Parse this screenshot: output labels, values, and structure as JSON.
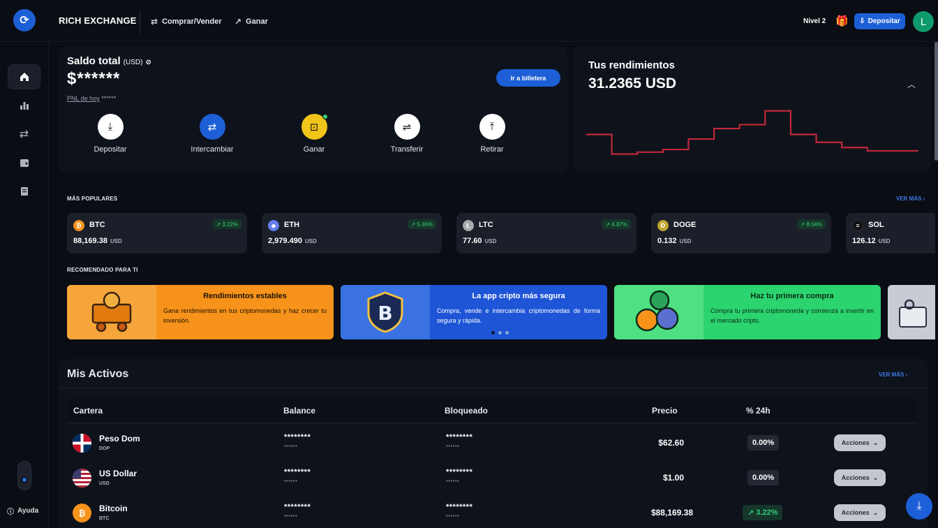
{
  "topbar": {
    "brand": "RICH EXCHANGE",
    "nav": [
      {
        "label": "Comprar/Vender",
        "icon": "swap-icon"
      },
      {
        "label": "Ganar",
        "icon": "trend-up-icon"
      }
    ],
    "level": "Nivel 2",
    "deposit_label": "Depositar",
    "avatar_initial": "L"
  },
  "sidebar": {
    "items": [
      "home-icon",
      "chart-bar-icon",
      "swap-icon",
      "wallet-icon",
      "receipt-icon"
    ],
    "help_label": "Ayuda"
  },
  "balance": {
    "label": "Saldo total",
    "currency": "(USD)",
    "value": "$******",
    "pnl_label": "PNL de hoy",
    "pnl_value": "******",
    "wallet_button": "Ir a billetera"
  },
  "actions": [
    {
      "label": "Depositar",
      "icon": "deposit-icon",
      "color": "#ffffff"
    },
    {
      "label": "Intercambiar",
      "icon": "swap-icon",
      "color": "#1d5fd6"
    },
    {
      "label": "Ganar",
      "icon": "earn-icon",
      "color": "#f0c419"
    },
    {
      "label": "Transferir",
      "icon": "transfer-icon",
      "color": "#ffffff"
    },
    {
      "label": "Retirar",
      "icon": "withdraw-icon",
      "color": "#ffffff"
    }
  ],
  "performance": {
    "title": "Tus rendimientos",
    "value": "31.2365 USD",
    "line_color": "#c0283a",
    "steps": [
      4,
      1,
      1.3,
      1.7,
      3.3,
      4.9,
      5.5,
      7.6,
      4,
      2.8,
      2,
      1.5,
      1.5
    ]
  },
  "popular": {
    "title": "MÁS POPULARES",
    "more": "VER MÁS",
    "coins": [
      {
        "symbol": "BTC",
        "price": "88,169.38",
        "unit": "USD",
        "change": "3.22%",
        "color": "#f7931a",
        "glyph": "₿"
      },
      {
        "symbol": "ETH",
        "price": "2,979.490",
        "unit": "USD",
        "change": "5.46%",
        "color": "#627eea",
        "glyph": "◆"
      },
      {
        "symbol": "LTC",
        "price": "77.60",
        "unit": "USD",
        "change": "4.87%",
        "color": "#a6a9aa",
        "glyph": "Ł"
      },
      {
        "symbol": "DOGE",
        "price": "0.132",
        "unit": "USD",
        "change": "8.04%",
        "color": "#c2a633",
        "glyph": "Ð"
      },
      {
        "symbol": "SOL",
        "price": "126.12",
        "unit": "USD",
        "change": "",
        "color": "#111111",
        "glyph": "≡"
      }
    ]
  },
  "recommended": {
    "title": "RECOMENDADO PARA TI",
    "banners": [
      {
        "title": "Rendimientos estables",
        "text": "Gana rendimientos en tus criptomonedas y haz crecer tu inversión.",
        "bg": "#f7931a",
        "art_bg": "#f5a53a",
        "text_color": "#1a1205",
        "icon": "mining-cart-icon"
      },
      {
        "title": "La app cripto más segura",
        "text": "Compra, vende e intercambia criptomonedas de forma segura y rápida.",
        "bg": "#1e55d6",
        "art_bg": "#3a72e3",
        "text_color": "#ffffff",
        "icon": "bitcoin-shield-icon"
      },
      {
        "title": "Haz tu primera compra",
        "text": "Compra tu primera criptomoneda y comienza a invertir en el mercado cripto.",
        "bg": "#2bd46e",
        "art_bg": "#4ee083",
        "text_color": "#0b2a16",
        "icon": "coins-icon"
      }
    ]
  },
  "assets": {
    "title": "Mis Activos",
    "more": "VER MÁS",
    "columns": [
      "Cartera",
      "Balance",
      "Bloqueado",
      "Precio",
      "% 24h"
    ],
    "rows": [
      {
        "name": "Peso Dom",
        "code": "DOP",
        "balance": "********",
        "balance_sub": "******",
        "locked": "********",
        "locked_sub": "******",
        "price": "$62.60",
        "change": "0.00%",
        "up": false,
        "flag": "dominican-flag-icon"
      },
      {
        "name": "US Dollar",
        "code": "USD",
        "balance": "********",
        "balance_sub": "******",
        "locked": "********",
        "locked_sub": "******",
        "price": "$1.00",
        "change": "0.00%",
        "up": false,
        "flag": "us-flag-icon"
      },
      {
        "name": "Bitcoin",
        "code": "BTC",
        "balance": "********",
        "balance_sub": "******",
        "locked": "********",
        "locked_sub": "******",
        "price": "$88,169.38",
        "change": "3.22%",
        "up": true,
        "flag": "bitcoin-icon"
      }
    ],
    "action_label": "Acciones"
  }
}
